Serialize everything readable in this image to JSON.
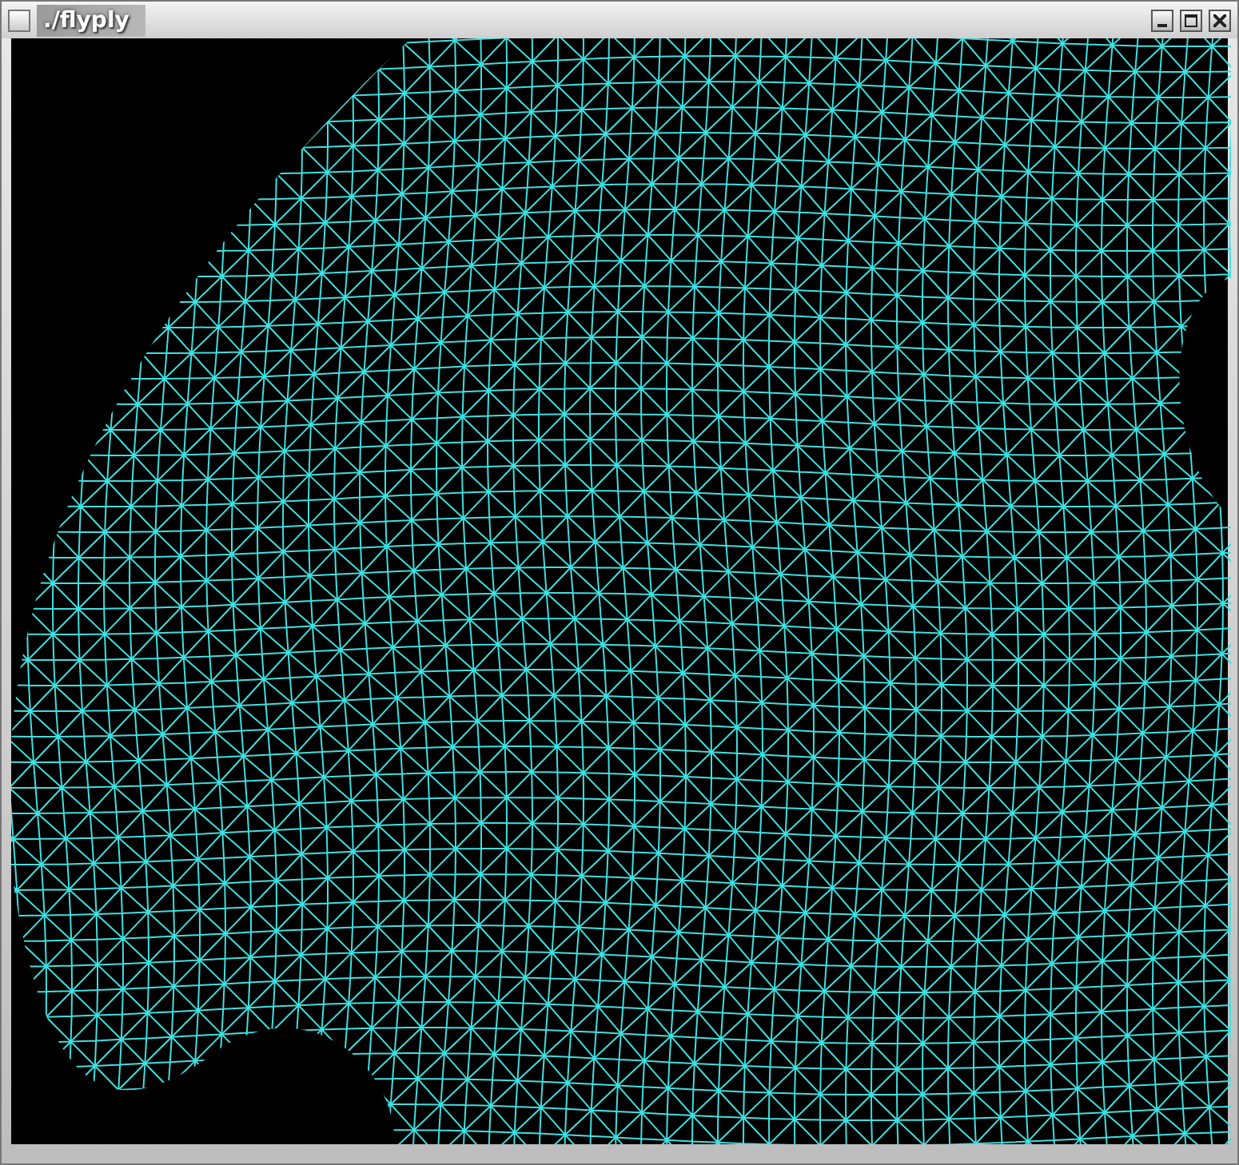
{
  "window": {
    "title": "./flyply"
  }
}
